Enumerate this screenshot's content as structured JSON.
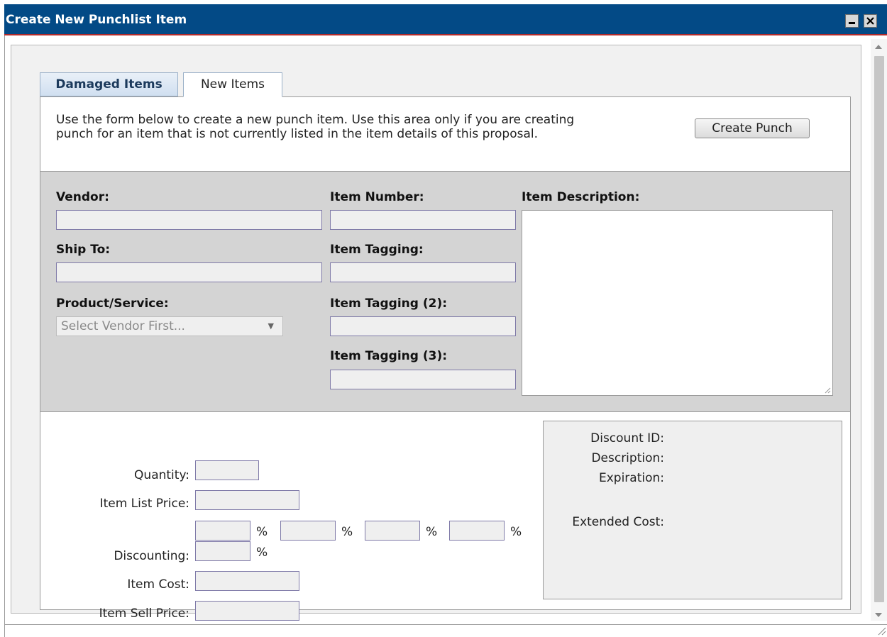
{
  "window": {
    "title": "Create New Punchlist Item",
    "minimize_label": "_",
    "close_label": "✕"
  },
  "tabs": [
    {
      "label": "Damaged Items",
      "active": false
    },
    {
      "label": "New Items",
      "active": true
    }
  ],
  "intro": {
    "line1": "Use the form below to create a new punch item. Use this area only if you are creating",
    "line2": "punch for an item that is not currently listed in the item details of this proposal.",
    "create_button": "Create Punch"
  },
  "form": {
    "vendor_label": "Vendor:",
    "vendor_value": "",
    "ship_to_label": "Ship To:",
    "ship_to_value": "",
    "product_service_label": "Product/Service:",
    "product_service_selected": "Select Vendor First...",
    "item_number_label": "Item Number:",
    "item_tagging_label": "Item Tagging:",
    "item_tagging2_label": "Item Tagging (2):",
    "item_tagging3_label": "Item Tagging (3):",
    "item_description_label": "Item Description:"
  },
  "pricing": {
    "quantity_label": "Quantity:",
    "list_price_label": "Item List Price:",
    "discounting_label": "Discounting:",
    "item_cost_label": "Item Cost:",
    "sell_price_label": "Item Sell Price:",
    "percent_symbol": "%"
  },
  "discount": {
    "discount_id_label": "Discount ID:",
    "description_label": "Description:",
    "expiration_label": "Expiration:",
    "extended_cost_label": "Extended Cost:"
  },
  "colors": {
    "titlebar": "#034a86",
    "titlebar_underline": "#b22b2b",
    "form_area": "#d4d4d4",
    "input_border": "#7f7aa8"
  }
}
